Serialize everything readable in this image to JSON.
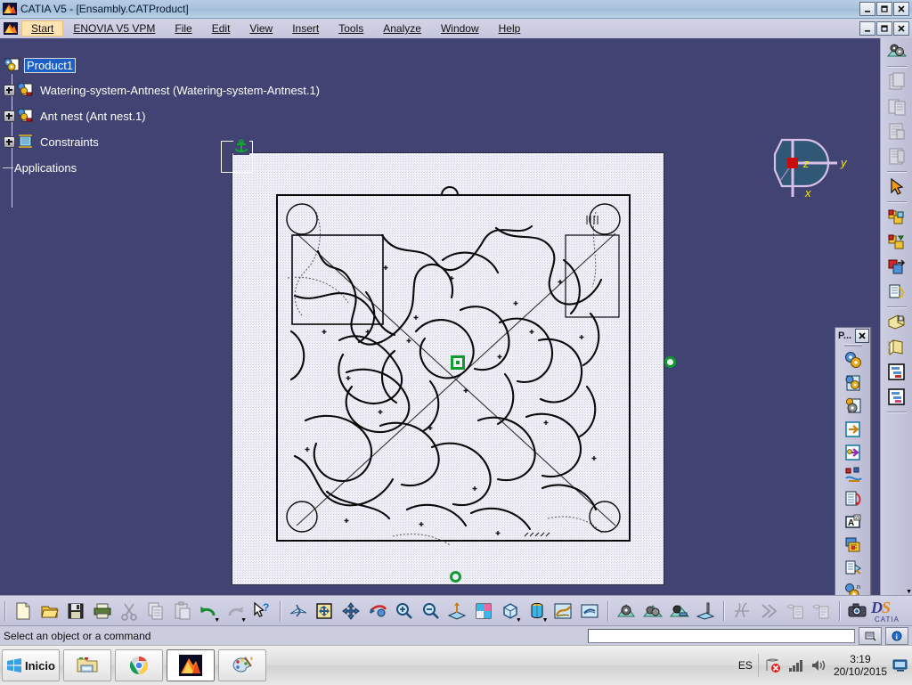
{
  "window": {
    "title": "CATIA V5 - [Ensambly.CATProduct]",
    "app_icon": "catia-icon",
    "minimize": "_",
    "maximize": "□",
    "close": "X"
  },
  "menubar": {
    "items": [
      {
        "label": "Start",
        "accel": "S",
        "highlighted": true
      },
      {
        "label": "ENOVIA V5 VPM",
        "accel": "E",
        "highlighted": false
      },
      {
        "label": "File",
        "accel": "F",
        "highlighted": false
      },
      {
        "label": "Edit",
        "accel": "E",
        "highlighted": false
      },
      {
        "label": "View",
        "accel": "V",
        "highlighted": false
      },
      {
        "label": "Insert",
        "accel": "I",
        "highlighted": false
      },
      {
        "label": "Tools",
        "accel": "T",
        "highlighted": false
      },
      {
        "label": "Analyze",
        "accel": "A",
        "highlighted": false
      },
      {
        "label": "Window",
        "accel": "W",
        "highlighted": false
      },
      {
        "label": "Help",
        "accel": "H",
        "highlighted": false
      }
    ],
    "doc_minimize": "_",
    "doc_restore": "□",
    "doc_close": "X"
  },
  "spec_tree": {
    "root": {
      "label": "Product1",
      "selected": true,
      "icon": "product-icon"
    },
    "children": [
      {
        "label": "Watering-system-Antnest (Watering-system-Antnest.1)",
        "icon": "part-icon",
        "expandable": true
      },
      {
        "label": "Ant nest (Ant nest.1)",
        "icon": "part-icon",
        "expandable": true
      },
      {
        "label": "Constraints",
        "icon": "constraints-icon",
        "expandable": true
      },
      {
        "label": "Applications",
        "icon": "none",
        "expandable": false
      }
    ]
  },
  "viewport": {
    "background_color": "#414372",
    "sheet_color": "#f2f2f8",
    "selection_color": "#0f9b2e",
    "compass": {
      "axis_x_label": "x",
      "axis_y_label": "y",
      "axis_z_label": "z",
      "label_color": "#ffe400",
      "ring_color": "#d8c0e8"
    }
  },
  "floating_toolbar": {
    "title": "P...",
    "close_label": "X",
    "overflow_label": "▼",
    "buttons": [
      {
        "name": "manage-representations-icon"
      },
      {
        "name": "new-part-from-product-icon"
      },
      {
        "name": "new-component-icon"
      },
      {
        "name": "insert-existing-component-icon"
      },
      {
        "name": "replace-component-icon"
      },
      {
        "name": "graph-tree-reorder-icon"
      },
      {
        "name": "generate-numbering-icon"
      },
      {
        "name": "selective-load-icon"
      },
      {
        "name": "manage-representations-2-icon"
      },
      {
        "name": "multi-instantiation-icon"
      },
      {
        "name": "fast-multi-instantiation-icon"
      }
    ]
  },
  "right_dock": {
    "buttons": [
      {
        "name": "update-icon",
        "enabled": true
      },
      {
        "name": "catalog-browser-icon",
        "enabled": false
      },
      {
        "name": "catalog-copy-icon",
        "enabled": false
      },
      {
        "name": "catalog-list-icon",
        "enabled": false
      },
      {
        "name": "catalog-detail-icon",
        "enabled": false
      },
      {
        "name": "select-arrow-icon",
        "enabled": true
      },
      {
        "name": "manipulation-icon",
        "enabled": true
      },
      {
        "name": "snap-icon",
        "enabled": true
      },
      {
        "name": "smart-move-icon",
        "enabled": true
      },
      {
        "name": "explode-icon",
        "enabled": true
      },
      {
        "name": "clash-detection-icon",
        "enabled": true
      },
      {
        "name": "sectioning-icon",
        "enabled": true
      },
      {
        "name": "distance-analysis-icon",
        "enabled": true
      },
      {
        "name": "scene-browser-icon",
        "enabled": true
      },
      {
        "name": "bill-of-material-icon",
        "enabled": true
      },
      {
        "name": "product-structure-icon",
        "enabled": true
      }
    ]
  },
  "bottom_toolbar": {
    "groups": [
      {
        "buttons": [
          {
            "name": "new-icon"
          },
          {
            "name": "open-icon"
          },
          {
            "name": "save-icon"
          },
          {
            "name": "print-icon"
          },
          {
            "name": "cut-icon"
          },
          {
            "name": "copy-icon"
          },
          {
            "name": "paste-icon"
          },
          {
            "name": "undo-icon",
            "dropdown": true
          },
          {
            "name": "redo-icon",
            "dropdown": true
          },
          {
            "name": "whats-this-icon"
          }
        ]
      },
      {
        "buttons": [
          {
            "name": "fly-mode-icon"
          },
          {
            "name": "fit-all-in-icon"
          },
          {
            "name": "pan-icon"
          },
          {
            "name": "rotate-icon"
          },
          {
            "name": "zoom-in-icon"
          },
          {
            "name": "zoom-out-icon"
          },
          {
            "name": "normal-view-icon"
          },
          {
            "name": "multi-view-icon"
          },
          {
            "name": "isometric-view-icon",
            "dropdown": true
          },
          {
            "name": "render-style-icon",
            "dropdown": true
          },
          {
            "name": "apply-material-icon"
          },
          {
            "name": "hide-show-icon"
          }
        ]
      },
      {
        "buttons": [
          {
            "name": "update-all-icon"
          },
          {
            "name": "manage-connections-icon"
          },
          {
            "name": "scene-icon"
          },
          {
            "name": "measure-icon"
          }
        ]
      },
      {
        "buttons": [
          {
            "name": "cut-section-icon"
          },
          {
            "name": "fast-forward-icon"
          },
          {
            "name": "annotation-icon"
          },
          {
            "name": "annotation-2-icon"
          }
        ]
      },
      {
        "buttons": [
          {
            "name": "capture-icon"
          }
        ]
      }
    ],
    "logo": "CATIA"
  },
  "statusbar": {
    "message": "Select an object or a command",
    "command_value": "",
    "command_placeholder": "",
    "buttons": [
      {
        "name": "power-input-icon"
      },
      {
        "name": "info-icon"
      }
    ]
  },
  "taskbar": {
    "start_label": "Inicio",
    "items": [
      {
        "name": "taskbar-explorer",
        "active": false
      },
      {
        "name": "taskbar-chrome",
        "active": false
      },
      {
        "name": "taskbar-catia",
        "active": true
      },
      {
        "name": "taskbar-paint",
        "active": false
      }
    ],
    "tray": {
      "language": "ES",
      "network_icon": "network-error-icon",
      "signal_icon": "signal-bars-icon",
      "volume_icon": "speaker-icon",
      "time": "3:19",
      "date": "20/10/2015",
      "show_desktop_icon": "show-desktop-icon"
    }
  }
}
